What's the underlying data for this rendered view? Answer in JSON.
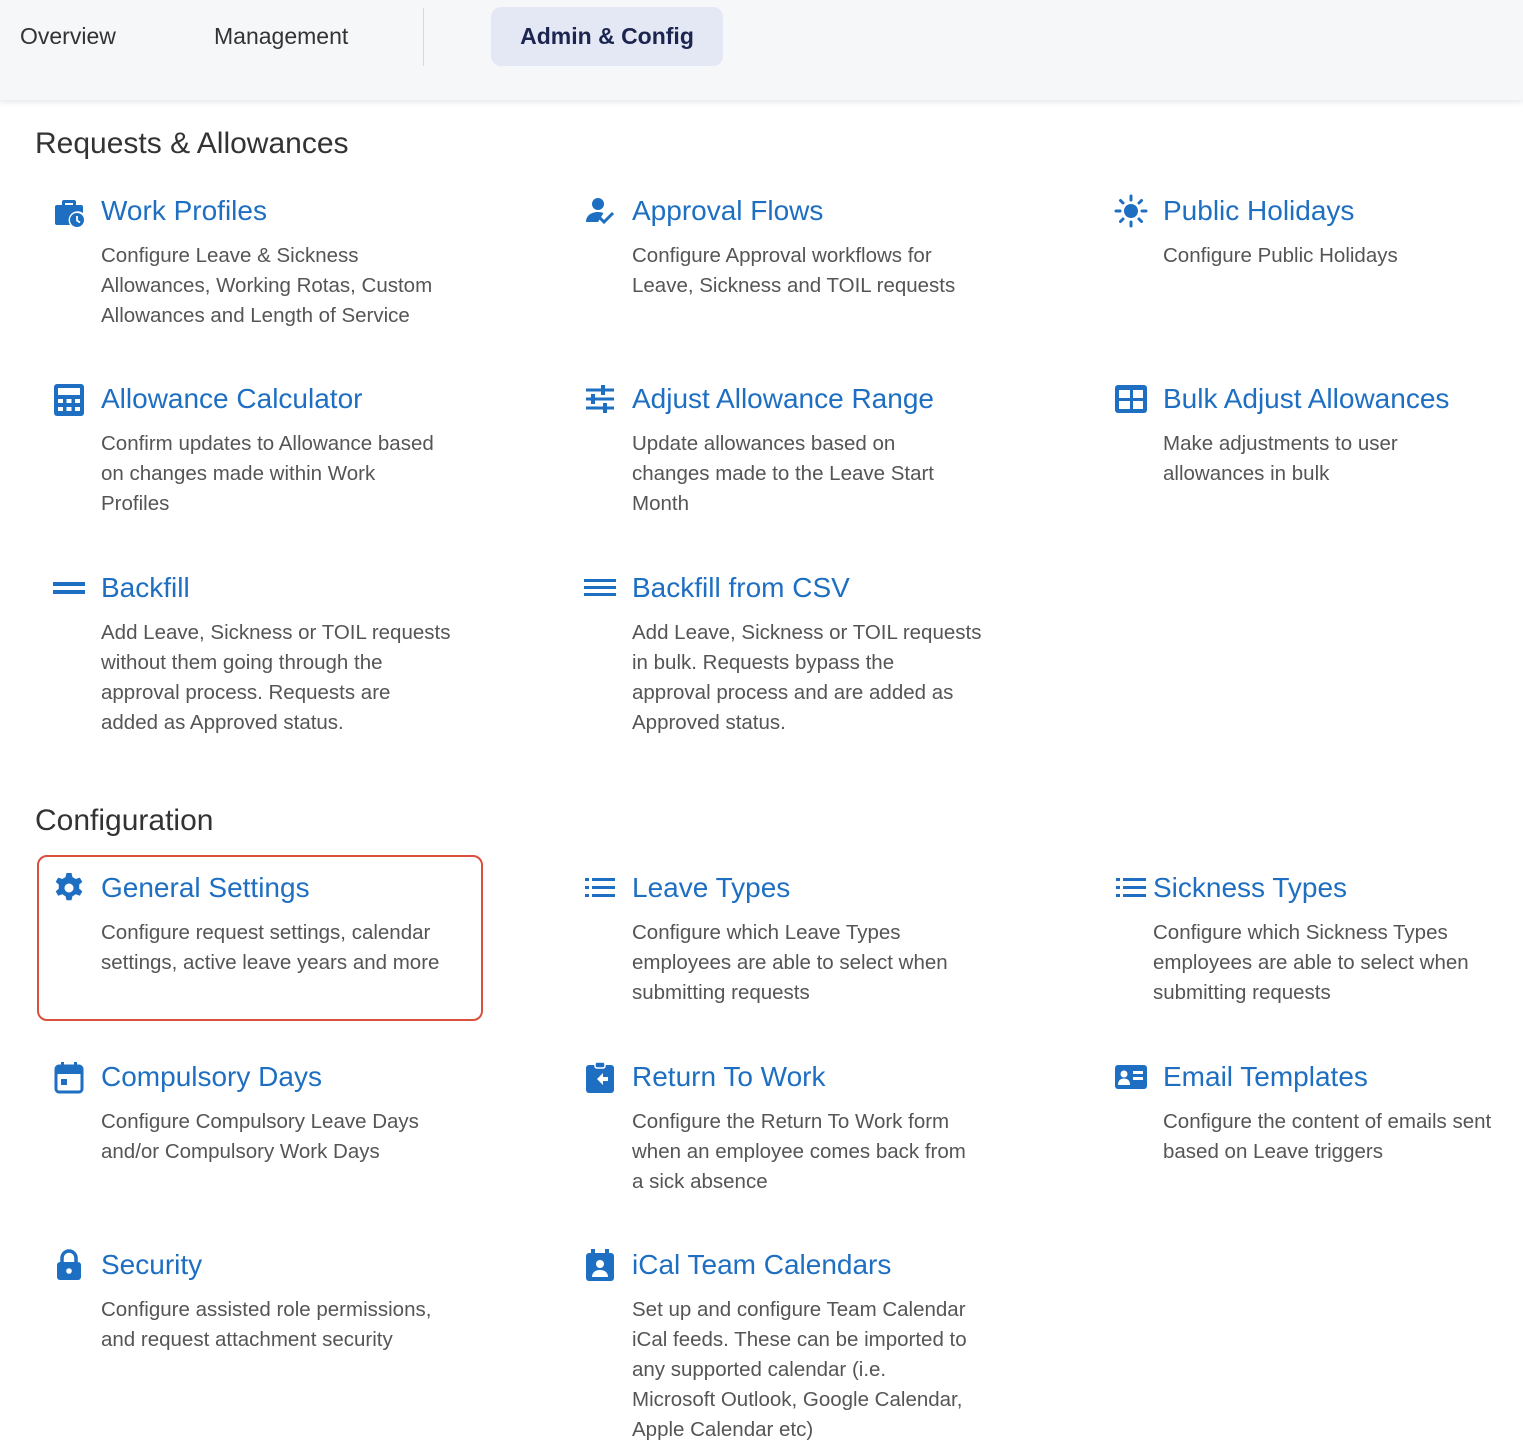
{
  "tabs": {
    "overview": "Overview",
    "management": "Management",
    "admin": "Admin & Config"
  },
  "sections": {
    "requests": "Requests & Allowances",
    "configuration": "Configuration"
  },
  "colors": {
    "accent": "#1e6fc2",
    "active_tab_bg": "#e4e8f4",
    "highlight_border": "#d9503f"
  },
  "cards": {
    "work_profiles": {
      "icon": "briefcase-clock-icon",
      "title": "Work Profiles",
      "desc1": "Configure Leave & Sickness",
      "desc2": "Allowances, Working Rotas, Custom",
      "desc3": "Allowances and Length of Service"
    },
    "approval_flows": {
      "icon": "person-check-icon",
      "title": "Approval Flows",
      "desc1": "Configure Approval workflows for",
      "desc2": "Leave, Sickness and TOIL requests"
    },
    "public_holidays": {
      "icon": "sun-icon",
      "title": "Public Holidays",
      "desc1": "Configure Public Holidays"
    },
    "allowance_calculator": {
      "icon": "calculator-icon",
      "title": "Allowance Calculator",
      "desc1": "Confirm updates to Allowance based",
      "desc2": "on changes made within Work",
      "desc3": "Profiles"
    },
    "adjust_allowance_range": {
      "icon": "sliders-icon",
      "title": "Adjust Allowance Range",
      "desc1": "Update allowances based on",
      "desc2": "changes made to the Leave Start",
      "desc3": "Month"
    },
    "bulk_adjust": {
      "icon": "grid-table-icon",
      "title": "Bulk Adjust Allowances",
      "desc1": "Make adjustments to user",
      "desc2": "allowances in bulk"
    },
    "backfill": {
      "icon": "equals-icon",
      "title": "Backfill",
      "desc1": "Add Leave, Sickness or TOIL requests",
      "desc2": "without them going through the",
      "desc3": "approval process. Requests are",
      "desc4": "added as Approved status."
    },
    "backfill_csv": {
      "icon": "menu-lines-icon",
      "title": "Backfill from CSV",
      "desc1": "Add Leave, Sickness or TOIL requests",
      "desc2": "in bulk. Requests bypass the",
      "desc3": "approval process and are added as",
      "desc4": "Approved status."
    },
    "general_settings": {
      "icon": "gear-icon",
      "title": "General Settings",
      "desc1": "Configure request settings, calendar",
      "desc2": "settings, active leave years and more"
    },
    "leave_types": {
      "icon": "bulleted-list-icon",
      "title": "Leave Types",
      "desc1": "Configure which Leave Types",
      "desc2": "employees are able to select when",
      "desc3": "submitting requests"
    },
    "sickness_types": {
      "icon": "bulleted-list-icon",
      "title": "Sickness Types",
      "desc1": "Configure which Sickness Types",
      "desc2": "employees are able to select when",
      "desc3": "submitting requests"
    },
    "compulsory_days": {
      "icon": "calendar-icon",
      "title": "Compulsory Days",
      "desc1": "Configure Compulsory Leave Days",
      "desc2": "and/or Compulsory Work Days"
    },
    "return_to_work": {
      "icon": "clipboard-return-icon",
      "title": "Return To Work",
      "desc1": "Configure the Return To Work form",
      "desc2": "when an employee comes back from",
      "desc3": "a sick absence"
    },
    "email_templates": {
      "icon": "contact-card-icon",
      "title": "Email Templates",
      "desc1": "Configure the content of emails sent",
      "desc2": "based on Leave triggers"
    },
    "security": {
      "icon": "lock-icon",
      "title": "Security",
      "desc1": "Configure assisted role permissions,",
      "desc2": "and request attachment security"
    },
    "ical": {
      "icon": "calendar-person-icon",
      "title": "iCal Team Calendars",
      "desc1": "Set up and configure Team Calendar",
      "desc2": "iCal feeds. These can be imported to",
      "desc3": "any supported calendar (i.e.",
      "desc4": "Microsoft Outlook, Google Calendar,",
      "desc5": "Apple Calendar etc)"
    }
  }
}
